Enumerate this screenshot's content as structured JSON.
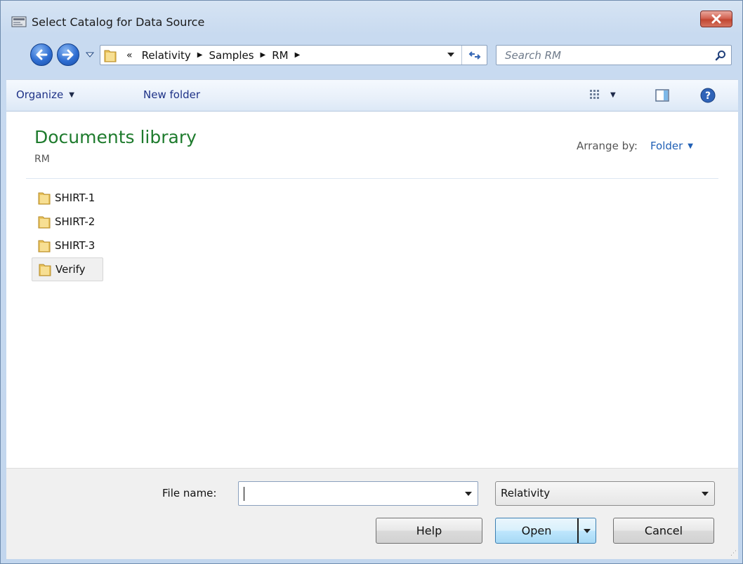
{
  "window": {
    "title": "Select Catalog for Data Source"
  },
  "nav": {
    "breadcrumb": [
      "«",
      "Relativity",
      "Samples",
      "RM"
    ],
    "search_placeholder": "Search RM"
  },
  "toolbar": {
    "organize_label": "Organize",
    "new_folder_label": "New folder"
  },
  "library": {
    "title": "Documents library",
    "subtitle": "RM",
    "arrange_label": "Arrange by:",
    "arrange_value": "Folder"
  },
  "files": [
    {
      "name": "SHIRT-1",
      "icon": "folder-icon"
    },
    {
      "name": "SHIRT-2",
      "icon": "folder-icon"
    },
    {
      "name": "SHIRT-3",
      "icon": "folder-icon"
    },
    {
      "name": "Verify",
      "icon": "folder-icon",
      "selected": true
    }
  ],
  "bottom": {
    "file_name_label": "File name:",
    "file_name_value": "",
    "filter_value": "Relativity",
    "help_label": "Help",
    "open_label": "Open",
    "cancel_label": "Cancel"
  },
  "colors": {
    "library_title": "#1e7b2d",
    "link_blue": "#1f5fb5",
    "close_red": "#c24732"
  }
}
